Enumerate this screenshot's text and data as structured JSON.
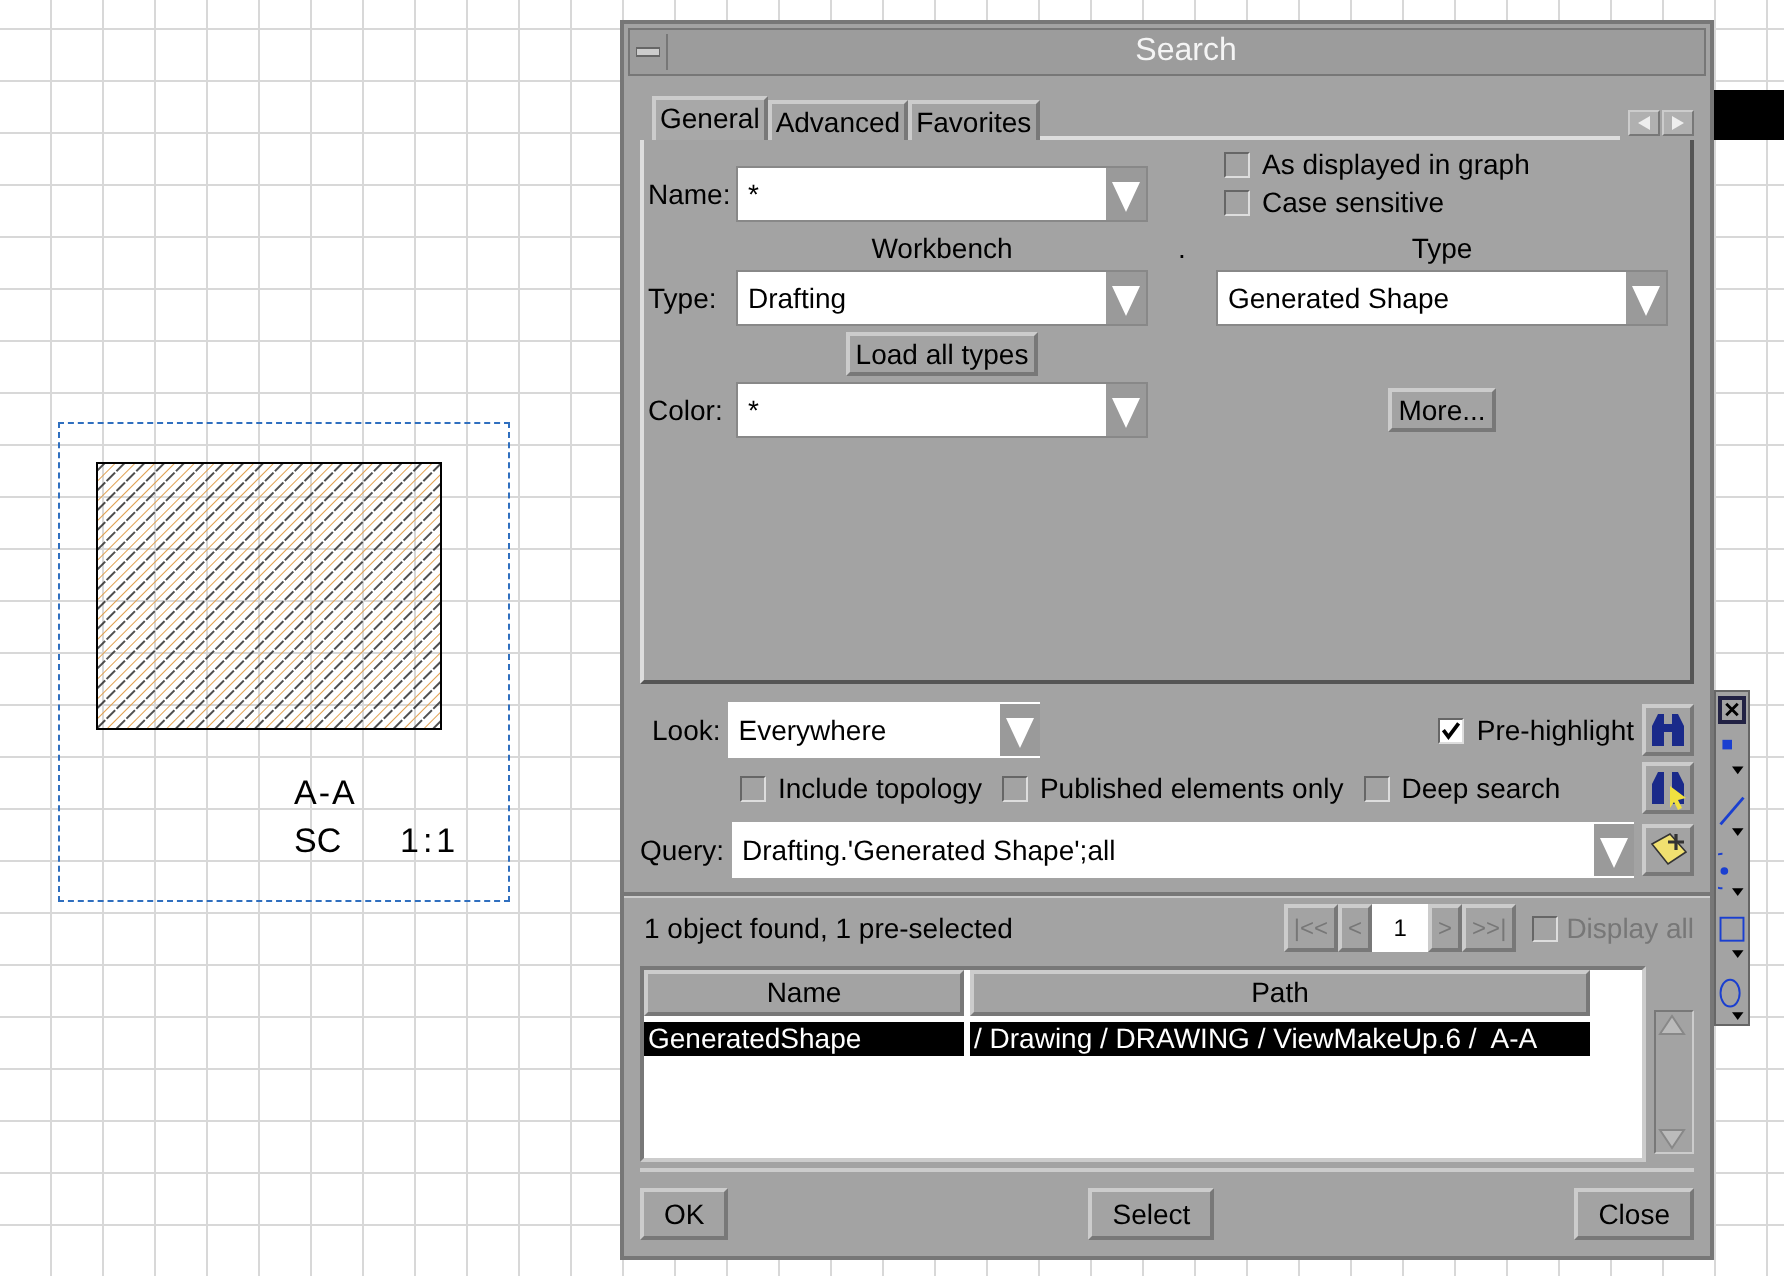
{
  "drawing": {
    "view_label": "A-A",
    "scale_label": "SC",
    "scale_value": "1:1"
  },
  "dialog": {
    "title": "Search",
    "tabs": [
      {
        "label": "General",
        "selected": true
      },
      {
        "label": "Advanced",
        "selected": false
      },
      {
        "label": "Favorites",
        "selected": false
      }
    ],
    "name": {
      "label": "Name:",
      "value": "*"
    },
    "options": [
      {
        "label": "As displayed in graph",
        "checked": false
      },
      {
        "label": "Case sensitive",
        "checked": false
      }
    ],
    "workbench_heading": "Workbench",
    "separator": ".",
    "type_heading": "Type",
    "type": {
      "label": "Type:",
      "workbench_value": "Drafting",
      "type_value": "Generated Shape"
    },
    "load_button": "Load all types",
    "color": {
      "label": "Color:",
      "value": "*"
    },
    "more_button": "More...",
    "look": {
      "label": "Look:",
      "value": "Everywhere"
    },
    "prehighlight": {
      "label": "Pre-highlight",
      "checked": true
    },
    "scope_options": [
      {
        "label": "Include topology",
        "checked": false
      },
      {
        "label": "Published elements only",
        "checked": false
      },
      {
        "label": "Deep search",
        "checked": false
      }
    ],
    "query": {
      "label": "Query:",
      "value": "Drafting.'Generated Shape';all"
    },
    "status": "1 object found, 1 pre-selected",
    "pager": [
      {
        "label": "|<<",
        "disabled": true
      },
      {
        "label": "<",
        "disabled": true
      }
    ],
    "page": "1",
    "pager_next": [
      {
        "label": ">",
        "disabled": true
      },
      {
        "label": ">>|",
        "disabled": true
      }
    ],
    "display_all": {
      "label": "Display all",
      "checked": false,
      "disabled": true
    },
    "table": {
      "columns": [
        "Name",
        "Path"
      ],
      "rows": [
        {
          "name": "GeneratedShape",
          "path": "/ Drawing / DRAWING / ViewMakeUp.6 /  A-A",
          "selected": true
        }
      ]
    },
    "buttons": [
      "OK",
      "Select",
      "Close"
    ]
  }
}
